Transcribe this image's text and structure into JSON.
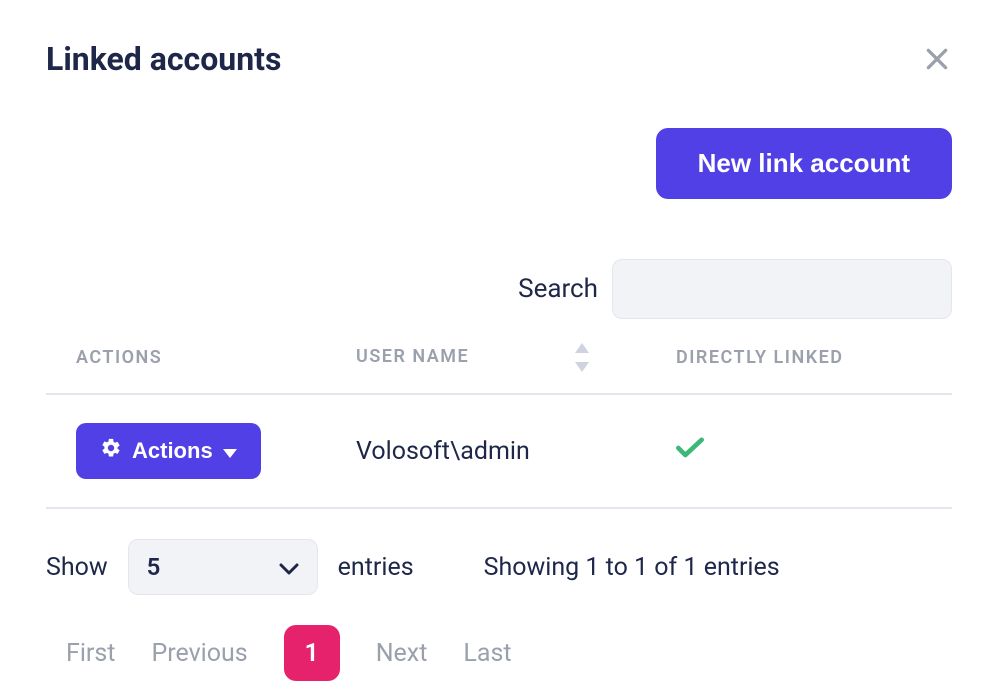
{
  "modal": {
    "title": "Linked accounts"
  },
  "buttons": {
    "new_link": "New link account",
    "actions": "Actions"
  },
  "search": {
    "label": "Search",
    "value": ""
  },
  "table": {
    "headers": {
      "actions": "Actions",
      "user_name": "User Name",
      "directly_linked": "Directly Linked"
    },
    "rows": [
      {
        "user_name": "Volosoft\\admin",
        "directly_linked": true
      }
    ]
  },
  "footer": {
    "show_label": "Show",
    "entries_label": "entries",
    "page_size": "5",
    "info": "Showing 1 to 1 of 1 entries",
    "pagination": {
      "first": "First",
      "previous": "Previous",
      "current": "1",
      "next": "Next",
      "last": "Last"
    }
  },
  "colors": {
    "primary": "#5040e6",
    "accent": "#e6226d",
    "success": "#3cb878"
  }
}
